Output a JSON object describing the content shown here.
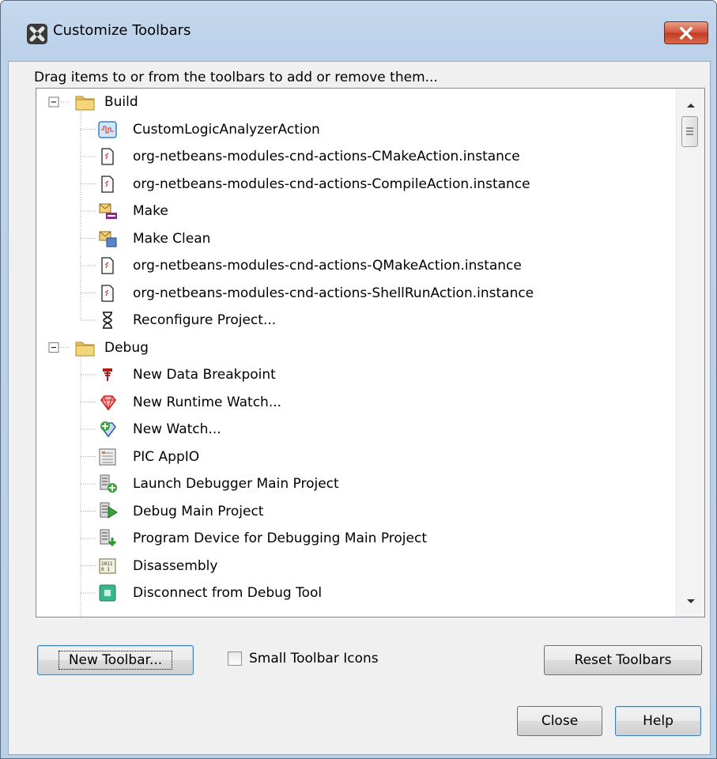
{
  "window": {
    "title": "Customize Toolbars"
  },
  "hint": "Drag items to or from the toolbars to add or remove them...",
  "tree": [
    {
      "category": "Build",
      "items": [
        {
          "label": "CustomLogicAnalyzerAction",
          "icon": "analyzer-icon"
        },
        {
          "label": "org-netbeans-modules-cnd-actions-CMakeAction.instance",
          "icon": "document-icon"
        },
        {
          "label": "org-netbeans-modules-cnd-actions-CompileAction.instance",
          "icon": "document-icon"
        },
        {
          "label": "Make",
          "icon": "make-icon"
        },
        {
          "label": "Make Clean",
          "icon": "make-clean-icon"
        },
        {
          "label": "org-netbeans-modules-cnd-actions-QMakeAction.instance",
          "icon": "document-icon"
        },
        {
          "label": "org-netbeans-modules-cnd-actions-ShellRunAction.instance",
          "icon": "document-icon"
        },
        {
          "label": "Reconfigure Project...",
          "icon": "hourglass-icon"
        }
      ]
    },
    {
      "category": "Debug",
      "items": [
        {
          "label": "New Data Breakpoint",
          "icon": "data-breakpoint-icon"
        },
        {
          "label": "New Runtime Watch...",
          "icon": "runtime-watch-icon"
        },
        {
          "label": "New Watch...",
          "icon": "watch-icon"
        },
        {
          "label": "PIC AppIO",
          "icon": "appio-icon"
        },
        {
          "label": "Launch Debugger Main Project",
          "icon": "launch-debugger-icon"
        },
        {
          "label": "Debug Main Project",
          "icon": "debug-project-icon"
        },
        {
          "label": "Program Device for Debugging Main Project",
          "icon": "program-device-icon"
        },
        {
          "label": "Disassembly",
          "icon": "disassembly-icon"
        },
        {
          "label": "Disconnect from Debug Tool",
          "icon": "disconnect-icon"
        }
      ]
    }
  ],
  "buttons": {
    "new_toolbar": "New Toolbar...",
    "reset_toolbars": "Reset Toolbars",
    "close": "Close",
    "help": "Help"
  },
  "small_icons": {
    "label": "Small Toolbar Icons",
    "checked": false
  }
}
